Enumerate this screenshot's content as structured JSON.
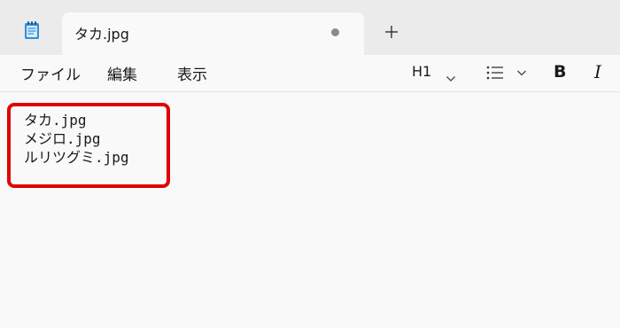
{
  "tab": {
    "title": "タカ.jpg",
    "unsaved_indicator": "dot",
    "new_tab_icon": "plus-icon"
  },
  "app_icon": "notepad-icon",
  "menu": {
    "file": "ファイル",
    "edit": "編集",
    "view": "表示"
  },
  "toolbar": {
    "heading": "H1",
    "list_icon": "bulleted-list-icon",
    "bold": "B",
    "italic": "I"
  },
  "editor": {
    "lines": [
      "タカ.jpg",
      "メジロ.jpg",
      "ルリツグミ.jpg"
    ]
  },
  "annotation": {
    "box_color": "#e00000"
  }
}
